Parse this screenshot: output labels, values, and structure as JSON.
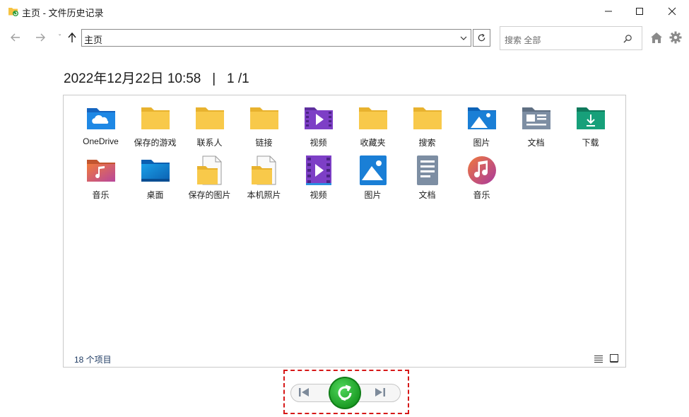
{
  "window": {
    "title": "主页 - 文件历史记录",
    "controls": [
      "minimize",
      "maximize",
      "close"
    ]
  },
  "navbar": {
    "address": "主页",
    "search_placeholder": "搜索 全部"
  },
  "header": {
    "date": "2022年12月22日 10:58",
    "separator": "|",
    "page": "1 /1"
  },
  "items": [
    {
      "label": "OneDrive",
      "icon": "onedrive-folder-icon"
    },
    {
      "label": "保存的游戏",
      "icon": "folder-icon"
    },
    {
      "label": "联系人",
      "icon": "folder-icon"
    },
    {
      "label": "链接",
      "icon": "folder-icon"
    },
    {
      "label": "视频",
      "icon": "videos-folder-icon"
    },
    {
      "label": "收藏夹",
      "icon": "folder-icon"
    },
    {
      "label": "搜索",
      "icon": "folder-icon"
    },
    {
      "label": "图片",
      "icon": "pictures-folder-icon"
    },
    {
      "label": "文档",
      "icon": "documents-folder-icon"
    },
    {
      "label": "下载",
      "icon": "downloads-folder-icon"
    },
    {
      "label": "音乐",
      "icon": "music-folder-icon"
    },
    {
      "label": "桌面",
      "icon": "desktop-folder-icon"
    },
    {
      "label": "保存的图片",
      "icon": "folder-file-icon"
    },
    {
      "label": "本机照片",
      "icon": "folder-file-icon"
    },
    {
      "label": "视频",
      "icon": "videos-library-icon"
    },
    {
      "label": "图片",
      "icon": "pictures-library-icon"
    },
    {
      "label": "文档",
      "icon": "documents-library-icon"
    },
    {
      "label": "音乐",
      "icon": "music-library-icon"
    }
  ],
  "status": {
    "count": "18 个项目"
  },
  "colors": {
    "folder_yellow": "#f8c94a",
    "restore_green": "#1fae2c",
    "highlight_red": "#d61818"
  }
}
